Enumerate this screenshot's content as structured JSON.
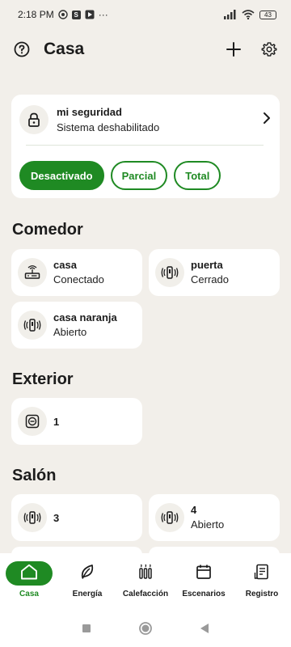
{
  "status_bar": {
    "time": "2:18 PM",
    "more": "···",
    "battery": "43"
  },
  "header": {
    "title": "Casa",
    "icons": [
      "help-icon",
      "add-icon",
      "settings-icon"
    ]
  },
  "security": {
    "name": "mi seguridad",
    "status": "Sistema deshabilitado",
    "modes": [
      {
        "label": "Desactivado",
        "active": true
      },
      {
        "label": "Parcial",
        "active": false
      },
      {
        "label": "Total",
        "active": false
      }
    ]
  },
  "sections": {
    "comedor": {
      "title": "Comedor",
      "devices": [
        {
          "name": "casa",
          "status": "Conectado",
          "icon": "router-icon"
        },
        {
          "name": "puerta",
          "status": "Cerrado",
          "icon": "door-sensor-icon"
        },
        {
          "name": "casa naranja",
          "status": "Abierto",
          "icon": "door-sensor-icon"
        }
      ]
    },
    "exterior": {
      "title": "Exterior",
      "devices": [
        {
          "name": "1",
          "icon": "plug-icon"
        }
      ]
    },
    "salon": {
      "title": "Salón",
      "devices": [
        {
          "name": "3",
          "icon": "door-sensor-icon"
        },
        {
          "name": "4",
          "status": "Abierto",
          "icon": "door-sensor-icon"
        }
      ]
    }
  },
  "bottom_nav": [
    {
      "label": "Casa",
      "icon": "home-icon",
      "active": true
    },
    {
      "label": "Energía",
      "icon": "leaf-icon",
      "active": false
    },
    {
      "label": "Calefacción",
      "icon": "radiator-icon",
      "active": false
    },
    {
      "label": "Escenarios",
      "icon": "calendar-icon",
      "active": false
    },
    {
      "label": "Registro",
      "icon": "log-icon",
      "active": false
    }
  ],
  "colors": {
    "accent": "#1f8a23",
    "background": "#f2efea",
    "card": "#ffffff"
  }
}
